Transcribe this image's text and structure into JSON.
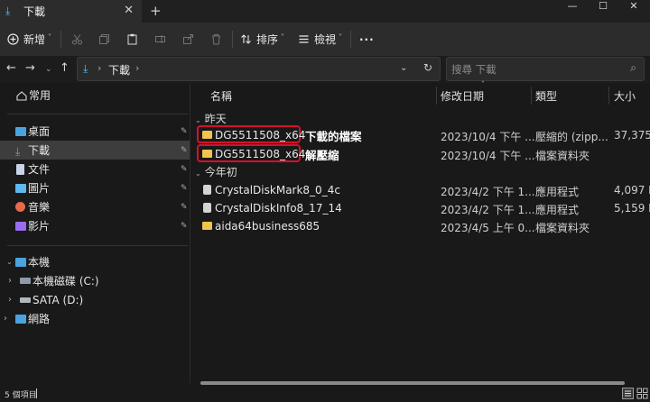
{
  "tab": {
    "title": "下載",
    "close": "✕",
    "add": "+"
  },
  "window": {
    "minimize": "—",
    "maximize": "☐",
    "close": "✕"
  },
  "toolbar": {
    "new_label": "新增",
    "sort_label": "排序",
    "view_label": "檢視",
    "more_label": "···",
    "caret": "˅"
  },
  "address": {
    "path": "下載",
    "chevron": "›",
    "dropdown": "⌄",
    "refresh": "↻",
    "search_placeholder": "搜尋 下載",
    "back": "←",
    "forward": "→",
    "recent": "⌄",
    "up": "↑"
  },
  "sidebar": {
    "home": "常用",
    "pinned": [
      {
        "label": "桌面",
        "color": "#4aa3df"
      },
      {
        "label": "下載",
        "color": "#3fc1a0"
      },
      {
        "label": "文件",
        "color": "#c9d3e6"
      },
      {
        "label": "圖片",
        "color": "#5fb8f0"
      },
      {
        "label": "音樂",
        "color": "#e36b4b"
      },
      {
        "label": "影片",
        "color": "#9b6cf0"
      }
    ],
    "pin_glyph": "📌",
    "this_pc": "本機",
    "drives": [
      {
        "label": "本機磁碟 (C:)"
      },
      {
        "label": "SATA (D:)"
      }
    ],
    "network": "網路",
    "expand": "›",
    "collapse": "⌄"
  },
  "columns": {
    "name": "名稱",
    "date": "修改日期",
    "type": "類型",
    "size": "大小",
    "sort_glyph": "˄"
  },
  "groups": {
    "yesterday": "昨天",
    "this_year": "今年初"
  },
  "files_yesterday": [
    {
      "name": "DG5511508_x64",
      "date": "2023/10/4 下午 ...",
      "type": "壓縮的 (zipp...",
      "size": "37,375",
      "icon": "folder",
      "annotation": "下載的檔案"
    },
    {
      "name": "DG5511508_x64",
      "date": "2023/10/4 下午 ...",
      "type": "檔案資料夾",
      "size": "",
      "icon": "folder",
      "annotation": "解壓縮"
    }
  ],
  "files_this_year": [
    {
      "name": "CrystalDiskMark8_0_4c",
      "date": "2023/4/2 下午 1...",
      "type": "應用程式",
      "size": "4,097 K",
      "icon": "exe"
    },
    {
      "name": "CrystalDiskInfo8_17_14",
      "date": "2023/4/2 下午 1...",
      "type": "應用程式",
      "size": "5,159 K",
      "icon": "exe"
    },
    {
      "name": "aida64business685",
      "date": "2023/4/5 上午 0...",
      "type": "檔案資料夾",
      "size": "",
      "icon": "folder"
    }
  ],
  "status": {
    "item_count": "5 個項目"
  },
  "colors": {
    "highlight_border": "#d3122c",
    "accent": "#4cc2ff",
    "folder": "#f1c34f"
  }
}
